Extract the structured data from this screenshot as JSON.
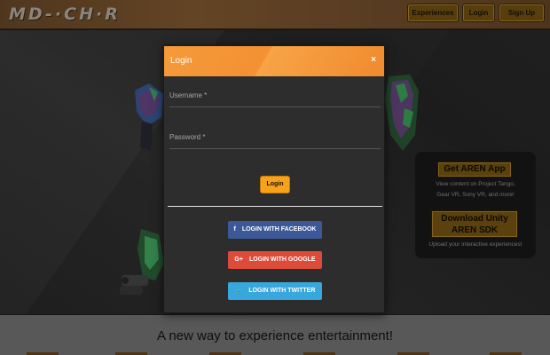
{
  "header": {
    "logo_text": "MD-·CH·R",
    "nav": {
      "experiences": "Experiences",
      "login": "Login",
      "signup": "Sign Up"
    }
  },
  "promo": {
    "app_button": "Get AREN App",
    "app_line1": "View content on Project Tango,",
    "app_line2": "Gear VR, Sony VR, and more!",
    "sdk_button_line1": "Download Unity",
    "sdk_button_line2": "AREN SDK",
    "sdk_text": "Upload your interactive experiences!"
  },
  "tagline": "A new way to experience entertainment!",
  "modal": {
    "title": "Login",
    "close_symbol": "×",
    "username_label": "Username *",
    "username_value": "",
    "password_label": "Password *",
    "password_value": "",
    "submit_label": "Login",
    "facebook_label": "LOGIN WITH FACEBOOK",
    "facebook_icon": "f",
    "google_label": "LOGIN WITH GOOGLE",
    "google_icon": "G+",
    "twitter_label": "LOGIN WITH TWITTER",
    "twitter_icon": "🐦"
  },
  "colors": {
    "modal_header": "#f39133",
    "login_button": "#f7a21a",
    "facebook": "#3b5998",
    "google": "#dd4b39",
    "twitter": "#38a7dd",
    "nav_button": "#7a5713"
  }
}
